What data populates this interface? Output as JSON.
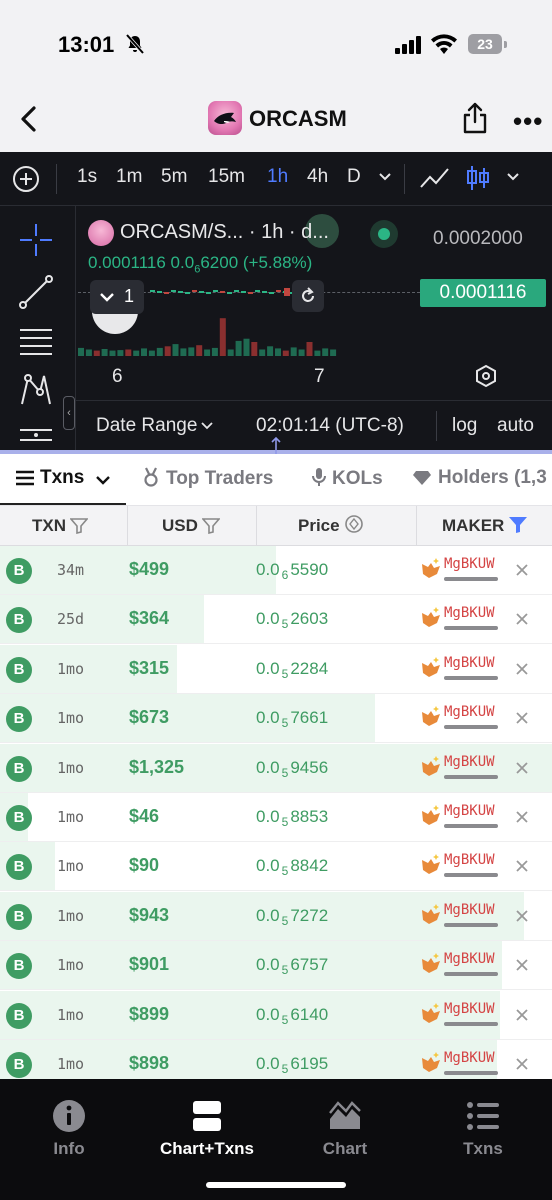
{
  "status_bar": {
    "time": "13:01",
    "battery": "23"
  },
  "header": {
    "title": "ORCASM"
  },
  "chart": {
    "timeframes": [
      "1s",
      "1m",
      "5m",
      "15m",
      "1h",
      "4h",
      "D"
    ],
    "active_timeframe": "1h",
    "pair": "ORCASM/S... · 1h · d...",
    "price_top": "0.0002000",
    "ohlc_prefix": "0.0001116  0.0",
    "ohlc_sub": "6",
    "ohlc_suffix": "6200 (+5.88%)",
    "current_price": "0.0001116",
    "collapse_count": "1",
    "x_labels": [
      "6",
      "7"
    ],
    "date_range_label": "Date Range",
    "clock": "02:01:14 (UTC-8)",
    "log_label": "log",
    "auto_label": "auto",
    "up_color": "#2bb585",
    "down_color": "#c0463f",
    "volume": [
      {
        "v": 0.15,
        "up": true
      },
      {
        "v": 0.12,
        "up": true
      },
      {
        "v": 0.1,
        "up": false
      },
      {
        "v": 0.13,
        "up": true
      },
      {
        "v": 0.1,
        "up": true
      },
      {
        "v": 0.11,
        "up": true
      },
      {
        "v": 0.12,
        "up": false
      },
      {
        "v": 0.1,
        "up": true
      },
      {
        "v": 0.14,
        "up": true
      },
      {
        "v": 0.1,
        "up": true
      },
      {
        "v": 0.15,
        "up": true
      },
      {
        "v": 0.18,
        "up": false
      },
      {
        "v": 0.22,
        "up": true
      },
      {
        "v": 0.14,
        "up": true
      },
      {
        "v": 0.16,
        "up": true
      },
      {
        "v": 0.2,
        "up": false
      },
      {
        "v": 0.12,
        "up": true
      },
      {
        "v": 0.15,
        "up": true
      },
      {
        "v": 0.7,
        "up": false
      },
      {
        "v": 0.12,
        "up": true
      },
      {
        "v": 0.28,
        "up": true
      },
      {
        "v": 0.32,
        "up": true
      },
      {
        "v": 0.26,
        "up": false
      },
      {
        "v": 0.12,
        "up": true
      },
      {
        "v": 0.18,
        "up": true
      },
      {
        "v": 0.14,
        "up": true
      },
      {
        "v": 0.1,
        "up": false
      },
      {
        "v": 0.16,
        "up": true
      },
      {
        "v": 0.12,
        "up": true
      },
      {
        "v": 0.26,
        "up": false
      },
      {
        "v": 0.1,
        "up": true
      },
      {
        "v": 0.14,
        "up": true
      },
      {
        "v": 0.12,
        "up": true
      }
    ]
  },
  "tabs": [
    {
      "label": "Txns"
    },
    {
      "label": "Top Traders"
    },
    {
      "label": "KOLs"
    },
    {
      "label": "Holders (1,3"
    }
  ],
  "columns": {
    "txn": "TXN",
    "usd": "USD",
    "price": "Price",
    "maker": "MAKER"
  },
  "rows": [
    {
      "side": "B",
      "age": "34m",
      "usd": "$499",
      "price_pre": "0.0",
      "price_sub": "6",
      "price_post": "5590",
      "maker": "MgBKUW",
      "share": 0.5
    },
    {
      "side": "B",
      "age": "25d",
      "usd": "$364",
      "price_pre": "0.0",
      "price_sub": "5",
      "price_post": "2603",
      "maker": "MgBKUW",
      "share": 0.37
    },
    {
      "side": "B",
      "age": "1mo",
      "usd": "$315",
      "price_pre": "0.0",
      "price_sub": "5",
      "price_post": "2284",
      "maker": "MgBKUW",
      "share": 0.32
    },
    {
      "side": "B",
      "age": "1mo",
      "usd": "$673",
      "price_pre": "0.0",
      "price_sub": "5",
      "price_post": "7661",
      "maker": "MgBKUW",
      "share": 0.68
    },
    {
      "side": "B",
      "age": "1mo",
      "usd": "$1,325",
      "price_pre": "0.0",
      "price_sub": "5",
      "price_post": "9456",
      "maker": "MgBKUW",
      "share": 1.0
    },
    {
      "side": "B",
      "age": "1mo",
      "usd": "$46",
      "price_pre": "0.0",
      "price_sub": "5",
      "price_post": "8853",
      "maker": "MgBKUW",
      "share": 0.05
    },
    {
      "side": "B",
      "age": "1mo",
      "usd": "$90",
      "price_pre": "0.0",
      "price_sub": "5",
      "price_post": "8842",
      "maker": "MgBKUW",
      "share": 0.1
    },
    {
      "side": "B",
      "age": "1mo",
      "usd": "$943",
      "price_pre": "0.0",
      "price_sub": "5",
      "price_post": "7272",
      "maker": "MgBKUW",
      "share": 0.95
    },
    {
      "side": "B",
      "age": "1mo",
      "usd": "$901",
      "price_pre": "0.0",
      "price_sub": "5",
      "price_post": "6757",
      "maker": "MgBKUW",
      "share": 0.91
    },
    {
      "side": "B",
      "age": "1mo",
      "usd": "$899",
      "price_pre": "0.0",
      "price_sub": "5",
      "price_post": "6140",
      "maker": "MgBKUW",
      "share": 0.905
    },
    {
      "side": "B",
      "age": "1mo",
      "usd": "$898",
      "price_pre": "0.0",
      "price_sub": "5",
      "price_post": "6195",
      "maker": "MgBKUW",
      "share": 0.9
    }
  ],
  "bottom_nav": [
    {
      "label": "Info"
    },
    {
      "label": "Chart+Txns"
    },
    {
      "label": "Chart"
    },
    {
      "label": "Txns"
    }
  ],
  "colors": {
    "accent": "#4f7bff",
    "buy": "#3f9c63",
    "maker": "#d44444"
  }
}
